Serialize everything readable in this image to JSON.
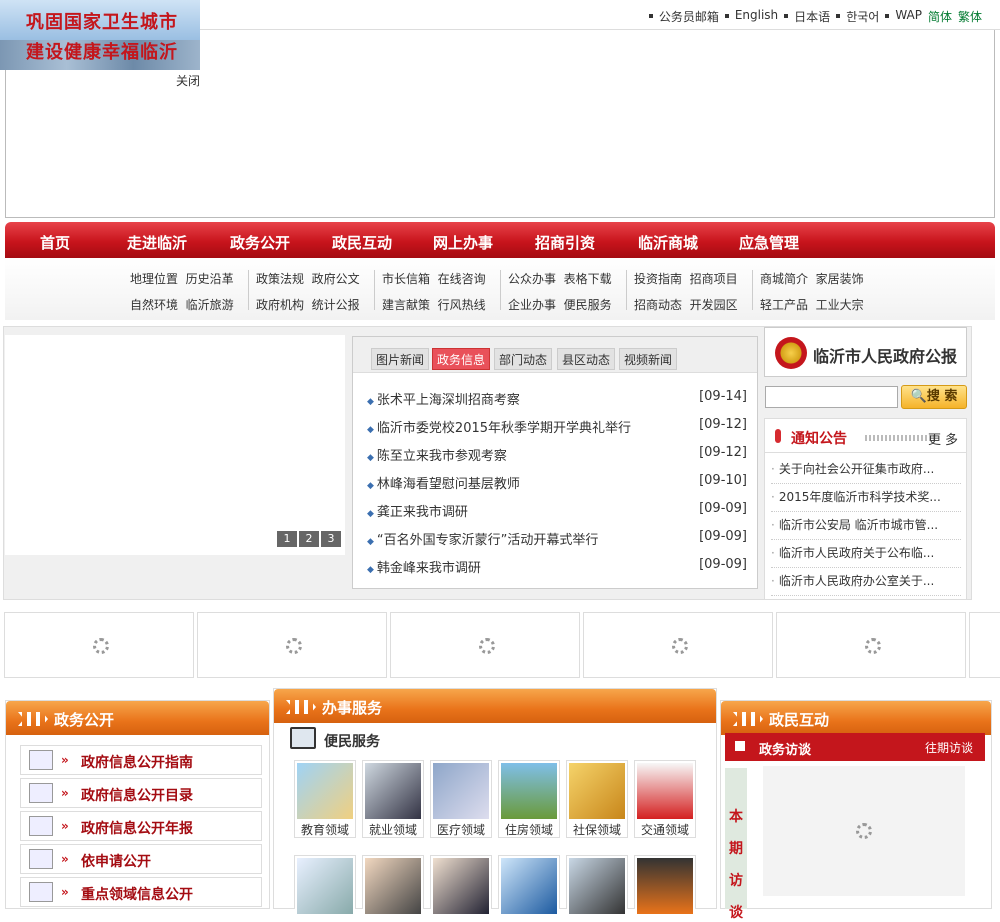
{
  "banner": {
    "line1": "巩固国家卫生城市",
    "line2": "建设健康幸福临沂",
    "close": "关闭"
  },
  "toplinks": [
    "公务员邮箱",
    "English",
    "日本语",
    "한국어",
    "WAP",
    "简体",
    "繁体"
  ],
  "mainnav": [
    "首页",
    "走进临沂",
    "政务公开",
    "政民互动",
    "网上办事",
    "招商引资",
    "临沂商城",
    "应急管理"
  ],
  "subnav": [
    {
      "row1": [
        "地理位置",
        "历史沿革"
      ],
      "row2": [
        "自然环境",
        "临沂旅游"
      ]
    },
    {
      "row1": [
        "政策法规",
        "政府公文"
      ],
      "row2": [
        "政府机构",
        "统计公报"
      ]
    },
    {
      "row1": [
        "市长信箱",
        "在线咨询"
      ],
      "row2": [
        "建言献策",
        "行风热线"
      ]
    },
    {
      "row1": [
        "公众办事",
        "表格下载"
      ],
      "row2": [
        "企业办事",
        "便民服务"
      ]
    },
    {
      "row1": [
        "投资指南",
        "招商项目"
      ],
      "row2": [
        "招商动态",
        "开发园区"
      ]
    },
    {
      "row1": [
        "商城简介",
        "家居装饰"
      ],
      "row2": [
        "轻工产品",
        "工业大宗"
      ]
    }
  ],
  "slide_pager": [
    "1",
    "2",
    "3"
  ],
  "news_tabs": [
    "图片新闻",
    "政务信息",
    "部门动态",
    "县区动态",
    "视频新闻"
  ],
  "news": [
    {
      "title": "张术平上海深圳招商考察",
      "date": "[09-14]"
    },
    {
      "title": "临沂市委党校2015年秋季学期开学典礼举行",
      "date": "[09-12]"
    },
    {
      "title": "陈至立来我市参观考察",
      "date": "[09-12]"
    },
    {
      "title": "林峰海看望慰问基层教师",
      "date": "[09-10]"
    },
    {
      "title": "龚正来我市调研",
      "date": "[09-09]"
    },
    {
      "title": "“百名外国专家沂蒙行”活动开幕式举行",
      "date": "[09-09]"
    },
    {
      "title": "韩金峰来我市调研",
      "date": "[09-09]"
    }
  ],
  "gov_gazette": "临沂市人民政府公报",
  "search": {
    "placeholder": "",
    "button": "搜 索"
  },
  "notice": {
    "title": "通知公告",
    "more": "更多",
    "items": [
      "关于向社会公开征集市政府...",
      "2015年度临沂市科学技术奖...",
      "临沂市公安局 临沂市城市管...",
      "临沂市人民政府关于公布临...",
      "临沂市人民政府办公室关于..."
    ]
  },
  "panels": {
    "gov_open": {
      "title": "政务公开",
      "items": [
        "政府信息公开指南",
        "政府信息公开目录",
        "政府信息公开年报",
        "依申请公开",
        "重点领域信息公开"
      ]
    },
    "service": {
      "title": "办事服务",
      "sub": "便民服务",
      "items": [
        "教育领域",
        "就业领域",
        "医疗领域",
        "住房领域",
        "社保领域",
        "交通领域"
      ]
    },
    "interact": {
      "title": "政民互动",
      "bar": "政务访谈",
      "more": "往期访谈",
      "side": [
        "本",
        "期",
        "访",
        "谈"
      ]
    }
  },
  "colors": {
    "accent": "#c4161c",
    "orange": "#e9731a",
    "link_blue": "#3b6fb0"
  }
}
